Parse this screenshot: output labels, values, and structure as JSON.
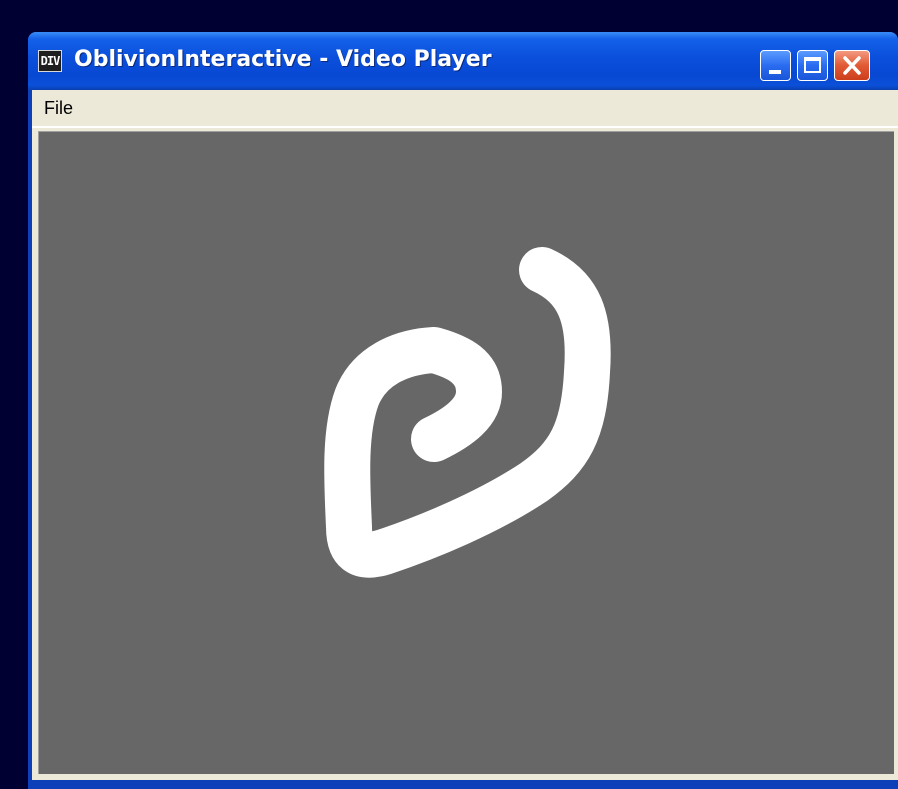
{
  "window": {
    "app_icon_text": "DIV",
    "title": "OblivionInteractive - Video Player"
  },
  "title_buttons": {
    "minimize_icon": "minimize-icon",
    "maximize_icon": "maximize-icon",
    "close_icon": "close-icon"
  },
  "menu": {
    "items": [
      "File"
    ]
  },
  "video": {
    "background_color": "#676767",
    "stroke_color": "#ffffff"
  },
  "colors": {
    "titlebar": "#0a4fdc",
    "close_button": "#e15a35",
    "desktop": "#000033"
  }
}
